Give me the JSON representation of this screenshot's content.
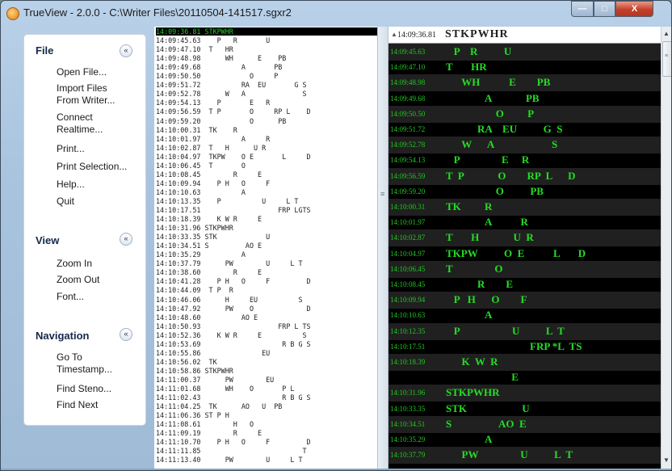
{
  "window": {
    "title": "TrueView - 2.0.0 - C:\\Writer Files\\20110504-141517.sgxr2",
    "controls": {
      "minimize": "—",
      "maximize": "□",
      "close": "X"
    }
  },
  "sidebar": {
    "file": {
      "title": "File",
      "toggle": "«",
      "items": [
        "Open File...",
        "Import Files\nFrom Writer...",
        "Connect\nRealtime...",
        "Print...",
        "Print Selection...",
        "Help...",
        "Quit"
      ]
    },
    "view": {
      "title": "View",
      "toggle": "«",
      "items": [
        "Zoom In",
        "Zoom Out",
        "Font..."
      ]
    },
    "navigation": {
      "title": "Navigation",
      "toggle": "«",
      "items": [
        "Go To\nTimestamp...",
        "Find Steno...",
        "Find Next"
      ]
    }
  },
  "text_lines": [
    "14:09:36.81 STKPWHR",
    "14:09:45.63    P   R       U",
    "14:09:47.10  T   HR",
    "14:09:48.98      WH      E    PB",
    "14:09:49.68          A       PB",
    "14:09:50.50            O     P",
    "14:09:51.72          RA  EU       G S",
    "14:09:52.78      W   A              S",
    "14:09:54.13    P       E   R",
    "14:09:56.59  T P       O     RP L    D",
    "14:09:59.20            O      PB",
    "14:10:00.31  TK    R",
    "14:10:01.97          A     R",
    "14:10:02.87  T   H      U R",
    "14:10:04.97  TKPW    O E       L     D",
    "14:10:06.45  T       O",
    "14:10:08.45        R     E",
    "14:10:09.94    P H   O     F",
    "14:10:10.63          A",
    "14:10:13.35    P          U     L T",
    "14:10:17.51                   FRP LGTS",
    "14:10:18.39    K W R     E",
    "14:10:31.96 STKPWHR",
    "14:10:33.35 STK            U",
    "14:10:34.51 S         AO E",
    "14:10:35.29          A",
    "14:10:37.79      PW        U     L T",
    "14:10:38.60        R     E",
    "14:10:41.28    P H   O     F         D",
    "14:10:44.09  T P  R",
    "14:10:46.06      H     EU          S",
    "14:10:47.92      PW    O             D",
    "14:10:48.60          AO E",
    "14:10:50.93                   FRP L TS",
    "14:10:52.36    K W R     E          S",
    "14:10:53.69                    R B G S",
    "14:10:55.86               EU",
    "14:10:56.02  TK",
    "14:10:58.86 STKPWHR",
    "14:11:00.37      PW        EU",
    "14:11:01.68      WH    O       P L",
    "14:11:02.43                    R B G S",
    "14:11:04.25  TK      AO   U  PB",
    "14:11:06.36 ST P H",
    "14:11:08.61        H   O",
    "14:11:09.19        R     E",
    "14:11:10.70    P H   O     F         D",
    "14:11:11.85                         T",
    "14:11:13.40      PW        U     L T"
  ],
  "steno_header": {
    "time": "14:09:36.81",
    "keys": "STKPWHR"
  },
  "steno_rows": [
    {
      "time": "14:09:45.63",
      "keys": "   P    R          U"
    },
    {
      "time": "14:09:47.10",
      "keys": "T       HR"
    },
    {
      "time": "14:09:48.98",
      "keys": "      WH           E        PB"
    },
    {
      "time": "14:09:49.68",
      "keys": "               A             PB"
    },
    {
      "time": "14:09:50.50",
      "keys": "                   O         P"
    },
    {
      "time": "14:09:51.72",
      "keys": "            RA    EU          G  S"
    },
    {
      "time": "14:09:52.78",
      "keys": "      W      A                      S"
    },
    {
      "time": "14:09:54.13",
      "keys": "   P                E     R"
    },
    {
      "time": "14:09:56.59",
      "keys": "T  P             O        RP  L      D"
    },
    {
      "time": "14:09:59.20",
      "keys": "                   O          PB"
    },
    {
      "time": "14:10:00.31",
      "keys": "TK         R"
    },
    {
      "time": "14:10:01.97",
      "keys": "               A           R"
    },
    {
      "time": "14:10:02.87",
      "keys": "T       H             U  R"
    },
    {
      "time": "14:10:04.97",
      "keys": "TKPW          O  E           L       D"
    },
    {
      "time": "14:10:06.45",
      "keys": "T                O"
    },
    {
      "time": "14:10:08.45",
      "keys": "            R        E"
    },
    {
      "time": "14:10:09.94",
      "keys": "   P   H      O        F"
    },
    {
      "time": "14:10:10.63",
      "keys": "               A"
    },
    {
      "time": "14:10:12.35",
      "keys": "   P                    U          L  T"
    },
    {
      "time": "14:10:17.51",
      "keys": "                                FRP *L  TS"
    },
    {
      "time": "14:10:18.39",
      "keys": "      K  W  R"
    },
    {
      "time": "",
      "keys": "                         E"
    },
    {
      "time": "14:10:31.96",
      "keys": "STKPWHR"
    },
    {
      "time": "14:10:33.35",
      "keys": "STK                     U"
    },
    {
      "time": "14:10:34.51",
      "keys": "S                  AO  E"
    },
    {
      "time": "14:10:35.29",
      "keys": "               A"
    },
    {
      "time": "14:10:37.79",
      "keys": "      PW                U          L  T"
    }
  ]
}
